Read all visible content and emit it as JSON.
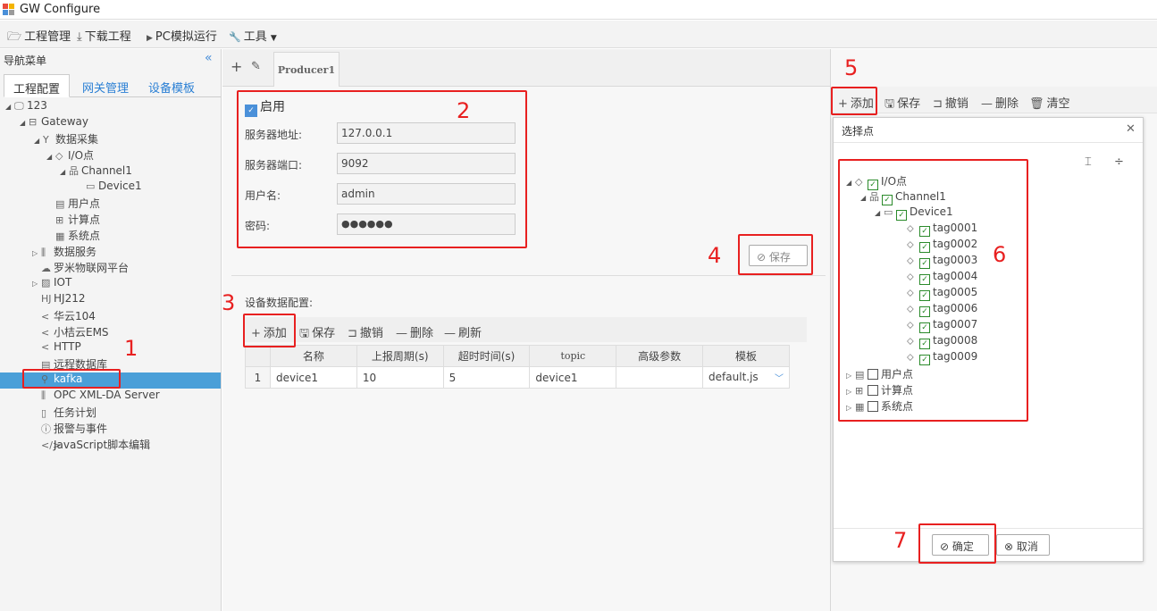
{
  "app": {
    "title": "GW Configure"
  },
  "menubar": {
    "items": [
      {
        "label": "工程管理",
        "icon": "folder-open-icon",
        "glyph": "🗁"
      },
      {
        "label": "下载工程",
        "icon": "download-icon",
        "glyph": "⤓"
      },
      {
        "label": "PC模拟运行",
        "icon": "play-icon",
        "glyph": "▶"
      },
      {
        "label": "工具",
        "icon": "wrench-icon",
        "glyph": "🔧"
      }
    ]
  },
  "sidebar": {
    "header": "导航菜单",
    "collapse_glyph": "«",
    "tabs": [
      "工程配置",
      "网关管理",
      "设备模板"
    ],
    "tree": [
      {
        "label": "123",
        "arrow": "◢",
        "icon": "🖵"
      },
      {
        "label": "Gateway",
        "arrow": "◢",
        "icon": "⊟"
      },
      {
        "label": "数据采集",
        "arrow": "◢",
        "icon": "Y"
      },
      {
        "label": "I/O点",
        "arrow": "◢",
        "icon": "◇"
      },
      {
        "label": "Channel1",
        "arrow": "◢",
        "icon": "品"
      },
      {
        "label": "Device1",
        "arrow": "",
        "icon": "▭"
      },
      {
        "label": "用户点",
        "arrow": "",
        "icon": "▤"
      },
      {
        "label": "计算点",
        "arrow": "",
        "icon": "⊞"
      },
      {
        "label": "系统点",
        "arrow": "",
        "icon": "▦"
      },
      {
        "label": "数据服务",
        "arrow": "▷",
        "icon": "⫼"
      },
      {
        "label": "罗米物联网平台",
        "arrow": "",
        "icon": "☁"
      },
      {
        "label": "IOT",
        "arrow": "▷",
        "icon": "▨"
      },
      {
        "label": "HJ212",
        "arrow": "",
        "icon": "HJ"
      },
      {
        "label": "华云104",
        "arrow": "",
        "icon": "<"
      },
      {
        "label": "小桔云EMS",
        "arrow": "",
        "icon": "<"
      },
      {
        "label": "HTTP",
        "arrow": "",
        "icon": "<"
      },
      {
        "label": "远程数据库",
        "arrow": "",
        "icon": "▤"
      },
      {
        "label": "kafka",
        "arrow": "",
        "icon": "⚲"
      },
      {
        "label": "OPC XML-DA Server",
        "arrow": "",
        "icon": "⫼"
      },
      {
        "label": "任务计划",
        "arrow": "",
        "icon": "▯"
      },
      {
        "label": "报警与事件",
        "arrow": "",
        "icon": "ⓘ"
      },
      {
        "label": "JavaScript脚本编辑",
        "arrow": "",
        "icon": "</>"
      }
    ]
  },
  "content": {
    "add_glyph": "+",
    "edit_glyph": "✎",
    "tab": "Producer1",
    "enable_label": "启用",
    "fields": [
      {
        "label": "服务器地址:",
        "value": "127.0.0.1"
      },
      {
        "label": "服务器端口:",
        "value": "9092"
      },
      {
        "label": "用户名:",
        "value": "admin"
      },
      {
        "label": "密码:",
        "value": "●●●●●●"
      }
    ],
    "save_label": "保存",
    "device_config_title": "设备数据配置:",
    "toolbar": [
      {
        "label": "添加",
        "glyph": "+"
      },
      {
        "label": "保存",
        "glyph": "🖫"
      },
      {
        "label": "撤销",
        "glyph": "⊐"
      },
      {
        "label": "删除",
        "glyph": "—"
      },
      {
        "label": "刷新",
        "glyph": "—"
      }
    ],
    "table": {
      "columns": [
        "名称",
        "上报周期(s)",
        "超时时间(s)",
        "topic",
        "高级参数",
        "模板"
      ],
      "rows": [
        {
          "index": "1",
          "cells": [
            "device1",
            "10",
            "5",
            "device1",
            "",
            "default.js"
          ]
        }
      ]
    }
  },
  "right": {
    "toolbar": [
      {
        "label": "添加",
        "glyph": "+"
      },
      {
        "label": "保存",
        "glyph": "🖫"
      },
      {
        "label": "撤销",
        "glyph": "⊐"
      },
      {
        "label": "删除",
        "glyph": "—"
      },
      {
        "label": "清空",
        "glyph": "🗑"
      }
    ]
  },
  "dialog": {
    "title": "选择点",
    "close_glyph": "✕",
    "expand_glyph": "⌶",
    "collapse_glyph": "÷",
    "tree": [
      {
        "label": "I/O点",
        "arrow": "◢",
        "icon": "◇",
        "checked": true
      },
      {
        "label": "Channel1",
        "arrow": "◢",
        "icon": "品",
        "checked": true
      },
      {
        "label": "Device1",
        "arrow": "◢",
        "icon": "▭",
        "checked": true
      },
      {
        "label": "tag0001",
        "arrow": "",
        "icon": "⬦",
        "checked": true
      },
      {
        "label": "tag0002",
        "arrow": "",
        "icon": "⬦",
        "checked": true
      },
      {
        "label": "tag0003",
        "arrow": "",
        "icon": "⬦",
        "checked": true
      },
      {
        "label": "tag0004",
        "arrow": "",
        "icon": "⬦",
        "checked": true
      },
      {
        "label": "tag0005",
        "arrow": "",
        "icon": "⬦",
        "checked": true
      },
      {
        "label": "tag0006",
        "arrow": "",
        "icon": "⬦",
        "checked": true
      },
      {
        "label": "tag0007",
        "arrow": "",
        "icon": "⬦",
        "checked": true
      },
      {
        "label": "tag0008",
        "arrow": "",
        "icon": "⬦",
        "checked": true
      },
      {
        "label": "tag0009",
        "arrow": "",
        "icon": "⬦",
        "checked": true
      },
      {
        "label": "用户点",
        "arrow": "▷",
        "icon": "▤",
        "checked": false
      },
      {
        "label": "计算点",
        "arrow": "▷",
        "icon": "⊞",
        "checked": false
      },
      {
        "label": "系统点",
        "arrow": "▷",
        "icon": "▦",
        "checked": false
      }
    ],
    "ok_label": "确定",
    "cancel_label": "取消"
  },
  "annotations": [
    "1",
    "2",
    "3",
    "4",
    "5",
    "6",
    "7"
  ],
  "colors": {
    "annotation": "#e82020",
    "selected": "#4a9fd8",
    "link": "#2a7fd4"
  }
}
